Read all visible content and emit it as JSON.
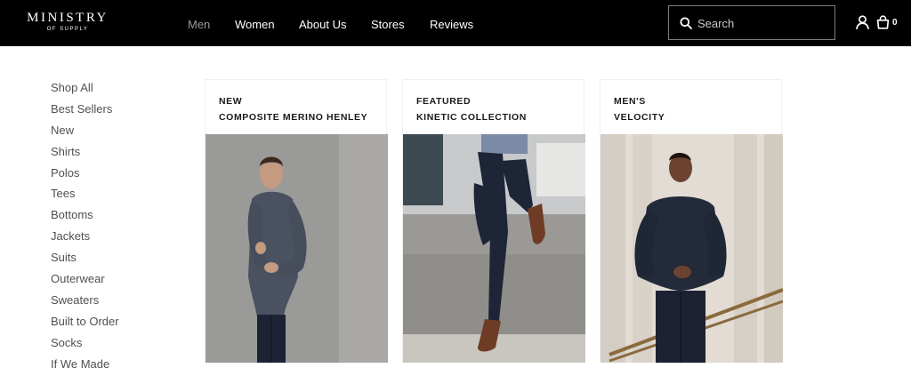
{
  "header": {
    "logo": {
      "name": "MINISTRY",
      "tagline": "OF SUPPLY"
    },
    "nav": [
      {
        "label": "Men",
        "active": true
      },
      {
        "label": "Women",
        "active": false
      },
      {
        "label": "About Us",
        "active": false
      },
      {
        "label": "Stores",
        "active": false
      },
      {
        "label": "Reviews",
        "active": false
      }
    ],
    "search": {
      "placeholder": "Search",
      "icon": "search-icon"
    },
    "account_icon": "user-icon",
    "cart": {
      "icon": "bag-icon",
      "count": "0"
    }
  },
  "sidebar": {
    "items": [
      {
        "label": "Shop All"
      },
      {
        "label": "Best Sellers"
      },
      {
        "label": "New"
      },
      {
        "label": "Shirts"
      },
      {
        "label": "Polos"
      },
      {
        "label": "Tees"
      },
      {
        "label": "Bottoms"
      },
      {
        "label": "Jackets"
      },
      {
        "label": "Suits"
      },
      {
        "label": "Outerwear"
      },
      {
        "label": "Sweaters"
      },
      {
        "label": "Built to Order"
      },
      {
        "label": "Socks"
      },
      {
        "label": "If We Made"
      }
    ]
  },
  "cards": [
    {
      "tag": "NEW",
      "title": "COMPOSITE MERINO HENLEY"
    },
    {
      "tag": "FEATURED",
      "title": "KINETIC COLLECTION"
    },
    {
      "tag": "MEN'S",
      "title": "VELOCITY"
    }
  ],
  "colors": {
    "nav_bg": "#000000",
    "nav_text": "#ffffff",
    "nav_active": "#9a9a9a",
    "sidebar_text": "#505050"
  }
}
